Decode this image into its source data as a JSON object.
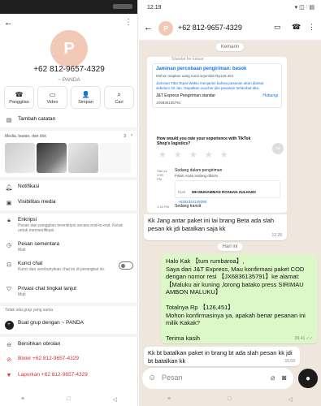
{
  "left": {
    "phone": "+62 812-9657-4329",
    "nick": "~ PANDA",
    "avatar_letter": "P",
    "actions": [
      {
        "icon": "☎",
        "label": "Panggilan"
      },
      {
        "icon": "▭",
        "label": "Video"
      },
      {
        "icon": "👤",
        "label": "Simpan"
      },
      {
        "icon": "⌕",
        "label": "Cari"
      }
    ],
    "add_note": "Tambah catatan",
    "media_title": "Media, tautan, dan dok",
    "media_count": "3",
    "notifications": "Notifikasi",
    "media_visibility": "Visibilitas media",
    "encryption": "Enkripsi",
    "encryption_sub": "Pesan dan panggilan terenkripsi secara end-to-end. Ketuk untuk memverifikasi.",
    "disappearing": "Pesan sementara",
    "disappearing_sub": "Mati",
    "lock": "Kunci chat",
    "lock_sub": "Kunci dan sembunyikan chat ini di perangkat ini.",
    "privacy": "Privasi chat tingkat lanjut",
    "privacy_sub": "Mati",
    "groups_head": "Tidak ada grup yang sama",
    "create_group": "Buat grup dengan ~ PANDA",
    "clear_chat": "Bersihkan obrolan",
    "block": "Blokir +62 812-9657-4329",
    "report": "Laporkan +62 812-9657-4329"
  },
  "right": {
    "time": "12.19",
    "status_icons": "▾ ◫ ⫶ ▤",
    "contact": "+62 812-9657-4329",
    "avatar_letter": "P",
    "day1": "Kemarin",
    "card": {
      "top": "Standar for keluar",
      "guarantee": "Jaminan percobaan pengiriman: besok",
      "voucher": "Mohon siapkan uang tunai sejumlah Rp126.451",
      "note": "Jaminan Tiba Tepat Waktu menjamin bahwa pesanan akan diantar sebelum 20 Jan. Dapatkan voucher jika pesanan terlambat tiba.",
      "carrier": "J&T Express Pengiriman standar",
      "contact_btn": "Hubungi",
      "resi": "JX6836135791",
      "rate": "How would you rate your experience with TikTok Shop's logistics?",
      "stars": "★ ★ ★ ★ ★",
      "today_time": "Hari ini 2:55 PM",
      "status1": "Sedang dalam pengiriman",
      "status1_sub": "Paket Anda sedang dikirim.",
      "courier_label": "Kurir",
      "courier": "MH MUHAMMAD ROSHAN ZULHAIDI",
      "courier_phone": "+6281344149395",
      "time2": "1:16 PM",
      "status2": "Sedang transit"
    },
    "msg1": "Kk Jang antar paket ini lai brang Beta ada slah pesan kk jdi batalkan saja kk",
    "msg1_time": "12.28",
    "day2": "Hari ini",
    "msg2": "Halo Kak 【tum rumbaroa】,\nSaya dari J&T Express, Mau konfirmasi paket COD dengan nomor resi 【JX6836135791】ke alamat:\n【Maluku  air kuning ,lorong batako press SIRIMAU AMBON MALUKU】\n\nTotalnya Rp 【126,451】\nMohon konfirmasinya ya, apakah benar pesanan ini milik Kakak?\n\nTerima kasih",
    "msg2_time": "09.41 ✓✓",
    "msg3": "Kk bt batalkan paket in brang bt ada slah pesan kk jdi bt batalkan kk",
    "msg3_time": "10.59",
    "placeholder": "Pesan"
  }
}
